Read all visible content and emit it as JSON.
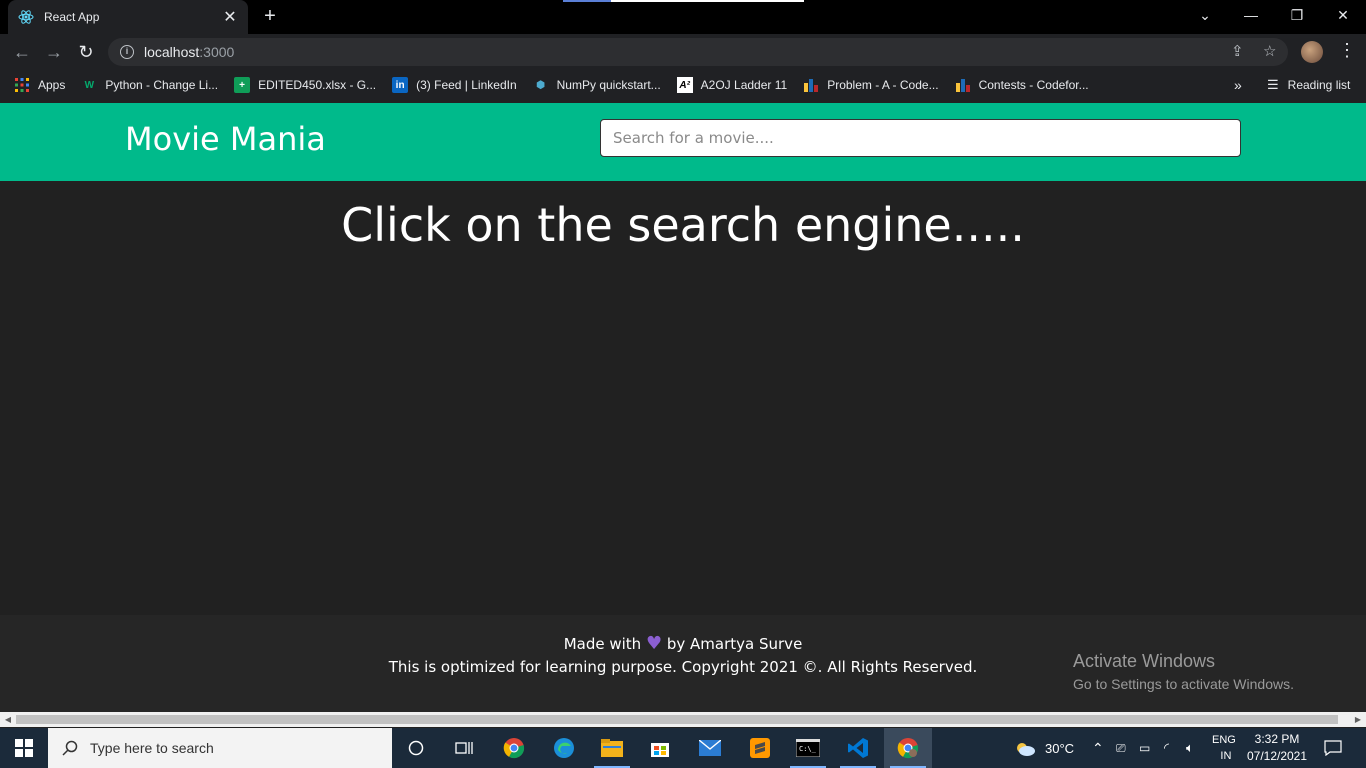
{
  "browser": {
    "tab_title": "React App",
    "url_host": "localhost",
    "url_port": ":3000",
    "bookmarks": [
      {
        "label": "Apps",
        "icon": "apps-grid-icon"
      },
      {
        "label": "Python - Change Li...",
        "icon": "w3-icon"
      },
      {
        "label": "EDITED450.xlsx - G...",
        "icon": "sheets-icon"
      },
      {
        "label": "(3) Feed | LinkedIn",
        "icon": "linkedin-icon"
      },
      {
        "label": "NumPy quickstart...",
        "icon": "numpy-icon"
      },
      {
        "label": "A2OJ Ladder 11",
        "icon": "a2oj-icon"
      },
      {
        "label": "Problem - A - Code...",
        "icon": "codeforces-icon"
      },
      {
        "label": "Contests - Codefor...",
        "icon": "codeforces-icon"
      }
    ],
    "more_bookmarks": "»",
    "reading_list": "Reading list"
  },
  "app": {
    "brand": "Movie Mania",
    "search_placeholder": "Search for a movie....",
    "headline": "Click on the search engine.....",
    "footer": {
      "made_with": "Made with",
      "by": "by Amartya Surve",
      "copyright": "This is optimized for learning purpose. Copyright 2021 ©. All Rights Reserved."
    },
    "colors": {
      "navbar": "#00ba8b",
      "background": "#212121",
      "heart": "#8b5fd1"
    }
  },
  "watermark": {
    "title": "Activate Windows",
    "subtitle": "Go to Settings to activate Windows."
  },
  "taskbar": {
    "search_placeholder": "Type here to search",
    "weather": "30°C",
    "lang_line1": "ENG",
    "lang_line2": "IN",
    "time": "3:32 PM",
    "date": "07/12/2021"
  }
}
